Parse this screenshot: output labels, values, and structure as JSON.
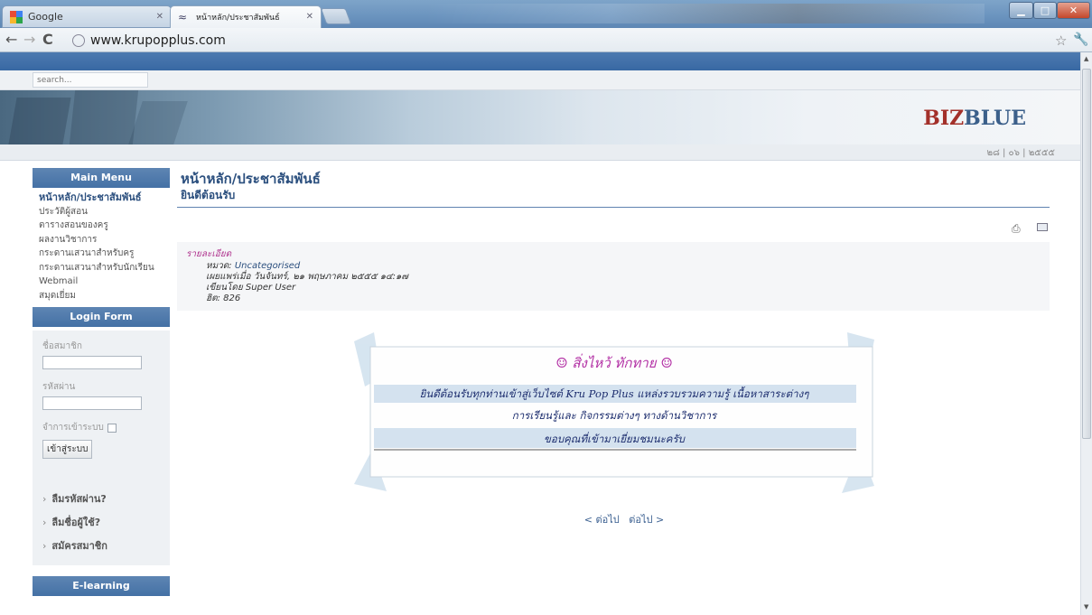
{
  "browser": {
    "tabs": [
      {
        "label": "Google",
        "active": false
      },
      {
        "label": "หน้าหลัก/ประชาสัมพันธ์",
        "active": true
      }
    ],
    "url": "www.krupopplus.com"
  },
  "site": {
    "search_placeholder": "search...",
    "logo_part1": "BIZ",
    "logo_part2": "BLUE",
    "date": "๒๘ | ๐๖ | ๒๕๕๕"
  },
  "sidebar": {
    "main_menu_title": "Main Menu",
    "items": [
      "หน้าหลัก/ประชาสัมพันธ์",
      "ประวัติผู้สอน",
      "ตารางสอนของครู",
      "ผลงานวิชาการ",
      "กระดานเสวนาสำหรับครู",
      "กระดานเสวนาสำหรับนักเรียน",
      "Webmail",
      "สมุดเยี่ยม"
    ],
    "login_title": "Login Form",
    "username_label": "ชื่อสมาชิก",
    "password_label": "รหัสผ่าน",
    "remember_label": "จำการเข้าระบบ",
    "login_button": "เข้าสู่ระบบ",
    "links": [
      "ลืมรหัสผ่าน?",
      "ลืมชื่อผู้ใช้?",
      "สมัครสมาชิก"
    ],
    "elearning_title": "E-learning"
  },
  "content": {
    "page_title": "หน้าหลัก/ประชาสัมพันธ์",
    "article_title": "ยินดีต้อนรับ",
    "details_heading": "รายละเอียด",
    "category_label": "หมวด:",
    "category_value": "Uncategorised",
    "published": "เผยแพร่เมื่อ วันจันทร์, ๒๑ พฤษภาคม ๒๕๕๕ ๑๔:๑๗",
    "author": "เขียนโดย Super User",
    "hits": "ฮิต: 826",
    "welcome_greeting": "☺ สิ่งไหว้ ทักทาย ☺",
    "welcome_line1": "ยินดีต้อนรับทุกท่านเข้าสู่เว็บไซต์ Kru Pop Plus แหล่งรวบรวมความรู้ เนื้อหาสาระต่างๆ",
    "welcome_line2": "การเรียนรู้และ กิจกรรมต่างๆ ทางด้านวิชาการ",
    "welcome_line3": "ขอบคุณที่เข้ามาเยี่ยมชมนะครับ",
    "pager_prev": "< ต่อไป",
    "pager_next": "ต่อไป >"
  },
  "colors": {
    "accent_blue": "#4471a5",
    "title_blue": "#2b4f7e",
    "logo_red": "#a3302a",
    "details_purple": "#b0358f"
  }
}
